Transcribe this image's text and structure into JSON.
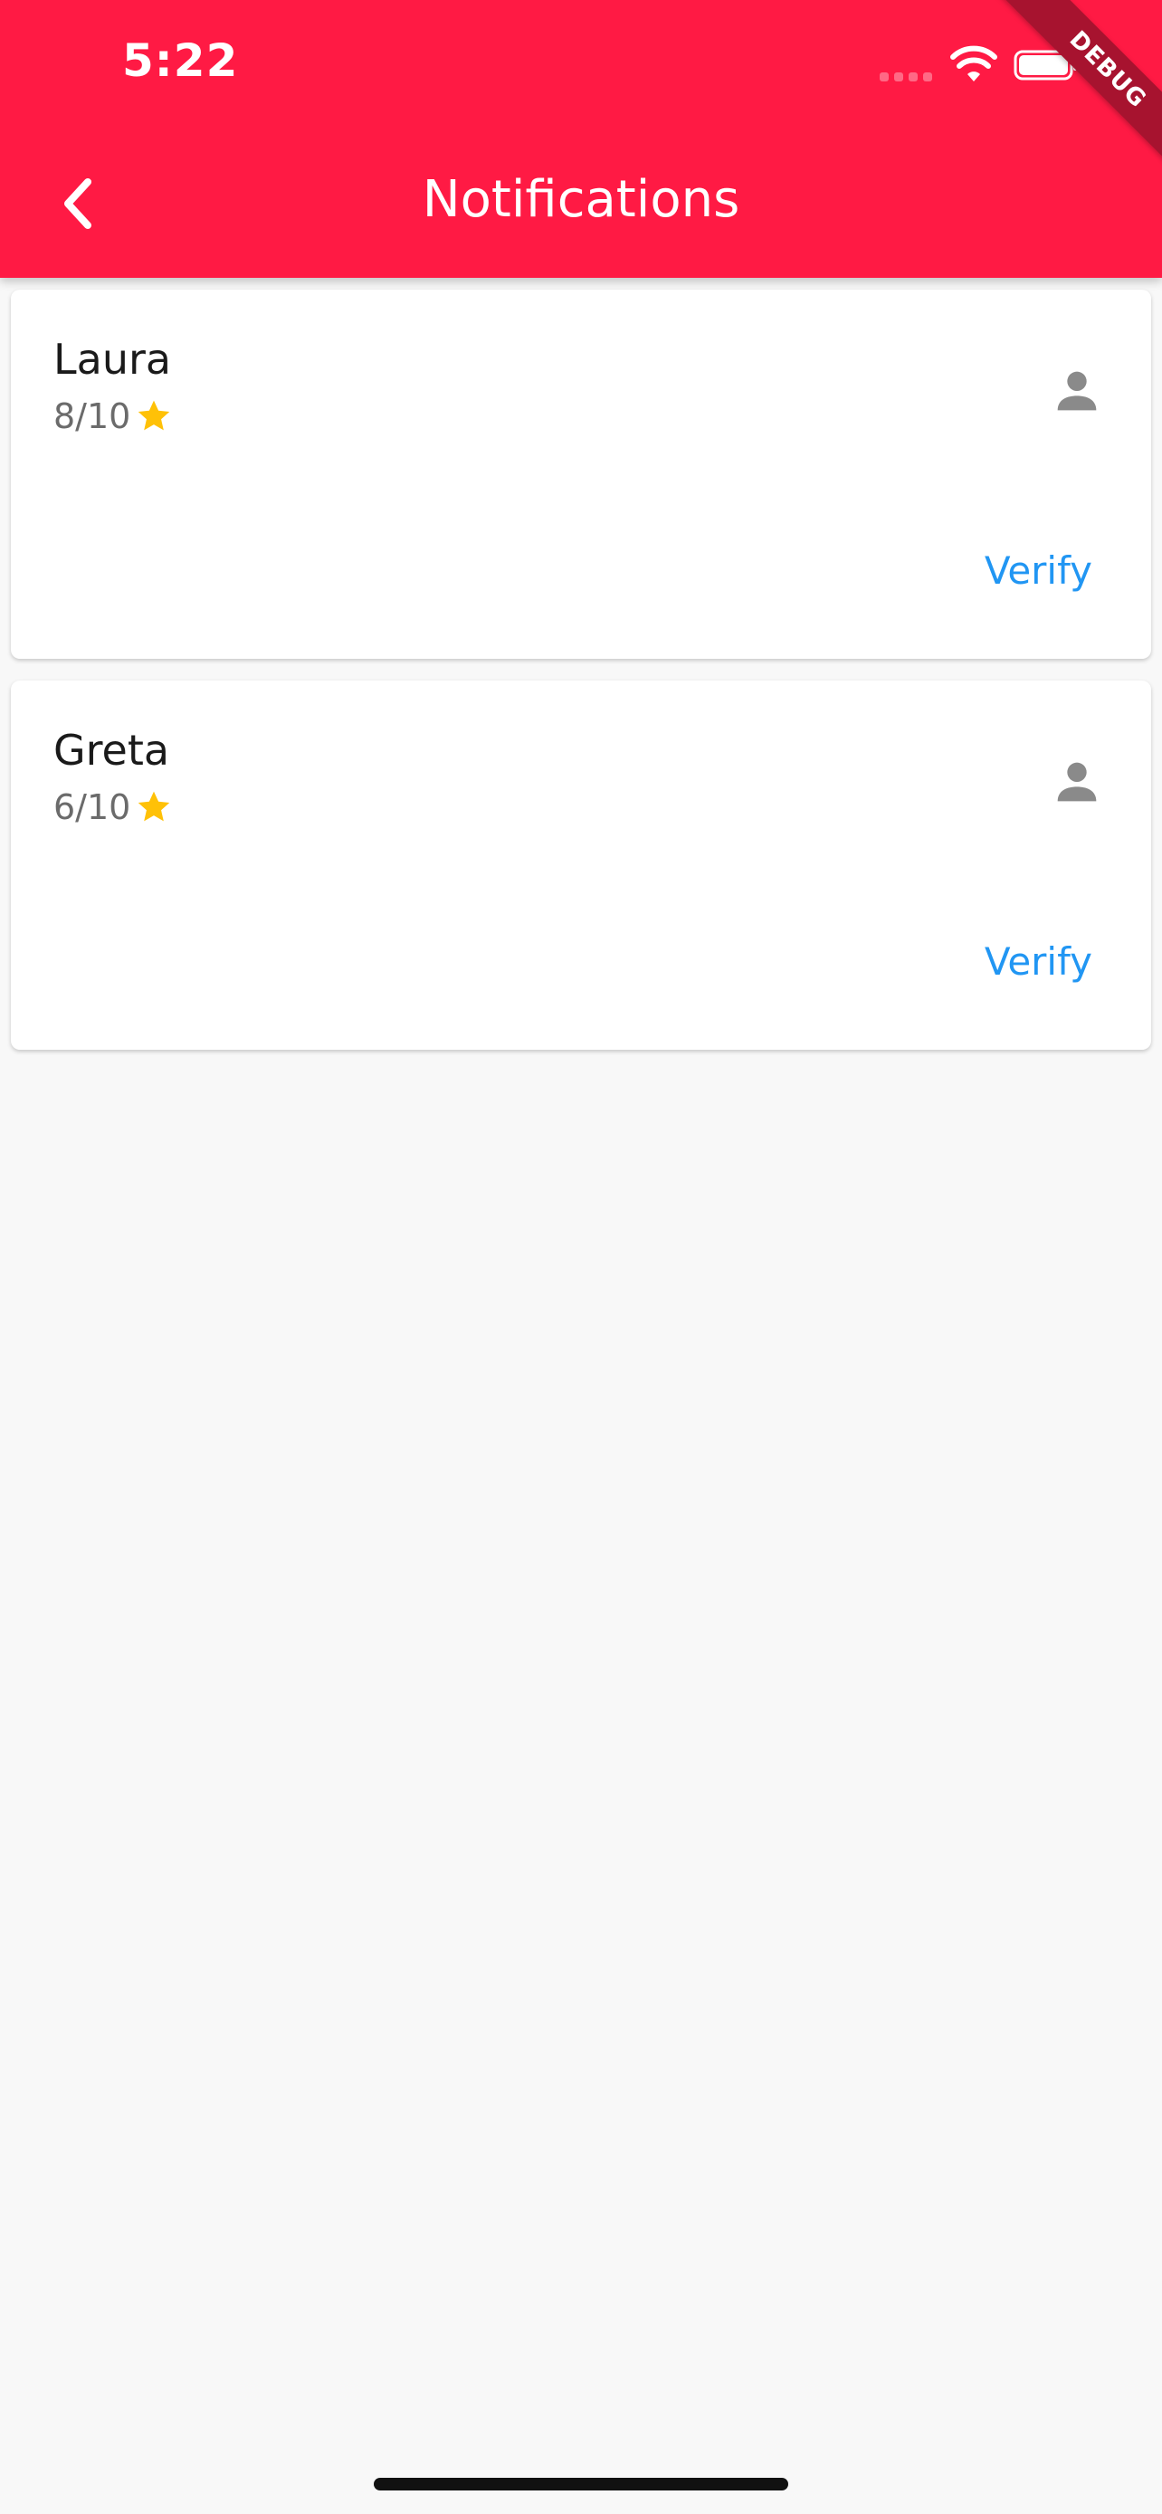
{
  "status_bar": {
    "time": "5:22",
    "debug_label": "DEBUG"
  },
  "header": {
    "title": "Notifications",
    "background_color": "#ff1a44",
    "back_icon": "chevron-left-icon"
  },
  "notifications": [
    {
      "name": "Laura",
      "rating": "8/10",
      "action_label": "Verify"
    },
    {
      "name": "Greta",
      "rating": "6/10",
      "action_label": "Verify"
    }
  ],
  "colors": {
    "accent": "#2196f3",
    "star": "#ffc107",
    "avatar": "#8a8a8a"
  }
}
